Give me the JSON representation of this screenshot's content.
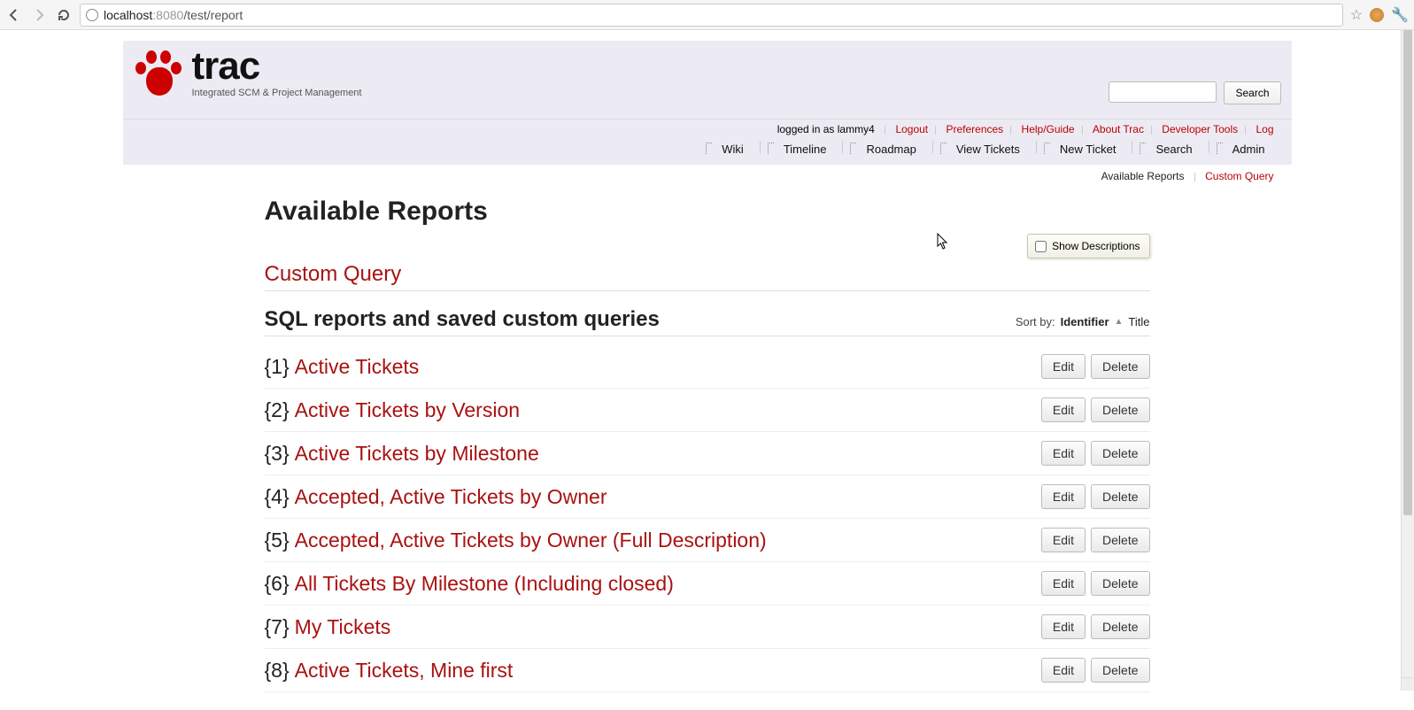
{
  "browser": {
    "url_host": "localhost",
    "url_port": ":8080",
    "url_path": "/test/report"
  },
  "logo": {
    "word": "trac",
    "subtitle": "Integrated SCM & Project Management"
  },
  "search": {
    "button": "Search",
    "value": ""
  },
  "metanav": {
    "logged_in": "logged in as lammy4",
    "links": [
      "Logout",
      "Preferences",
      "Help/Guide",
      "About Trac",
      "Developer Tools",
      "Log"
    ]
  },
  "mainnav": [
    "Wiki",
    "Timeline",
    "Roadmap",
    "View Tickets",
    "New Ticket",
    "Search",
    "Admin"
  ],
  "ctxtnav": {
    "active": "Available Reports",
    "links": [
      "Custom Query"
    ]
  },
  "page_title": "Available Reports",
  "show_descriptions": "Show Descriptions",
  "custom_query_heading": "Custom Query",
  "sql_heading": "SQL reports and saved custom queries",
  "sort": {
    "label": "Sort by:",
    "identifier": "Identifier",
    "title": "Title"
  },
  "reports": [
    {
      "id": "{1}",
      "title": "Active Tickets"
    },
    {
      "id": "{2}",
      "title": "Active Tickets by Version"
    },
    {
      "id": "{3}",
      "title": "Active Tickets by Milestone"
    },
    {
      "id": "{4}",
      "title": "Accepted, Active Tickets by Owner"
    },
    {
      "id": "{5}",
      "title": "Accepted, Active Tickets by Owner (Full Description)"
    },
    {
      "id": "{6}",
      "title": "All Tickets By Milestone (Including closed)"
    },
    {
      "id": "{7}",
      "title": "My Tickets"
    },
    {
      "id": "{8}",
      "title": "Active Tickets, Mine first"
    }
  ],
  "buttons": {
    "edit": "Edit",
    "delete": "Delete"
  }
}
